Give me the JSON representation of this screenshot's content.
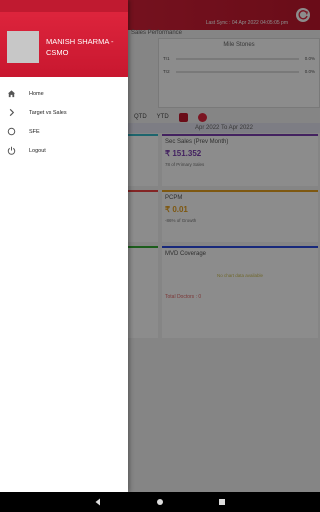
{
  "background": {
    "sync_text": "Last Sync : 04 Apr 2022 04:05:05 pm",
    "panel_title": "Sales Performance",
    "milestones_title": "Mile Stones",
    "milestone_rows": [
      {
        "label": "Tr1",
        "value": "0.0%"
      },
      {
        "label": "Tr2",
        "value": "0.0%"
      }
    ],
    "periods": [
      "QTD",
      "YTD"
    ],
    "date_range": "Apr 2022 To Apr 2022",
    "cards": [
      {
        "title": "Sec Sales (Prev Month)",
        "value": "₹ 151.352",
        "sub": "78 of Primary Sales"
      },
      {
        "title": "PCPM",
        "value": "₹ 0.01",
        "sub": "-86% of Growth"
      },
      {
        "title": "MVD Coverage",
        "no_data": "No chart data available",
        "footer": "Total Doctors : 0"
      }
    ]
  },
  "drawer": {
    "user_name": "MANISH SHARMA - CSMO",
    "items": [
      {
        "label": "Home",
        "icon": "home-icon"
      },
      {
        "label": "Target vs Sales",
        "icon": "chevron-right-icon"
      },
      {
        "label": "SFE",
        "icon": "radio-circle-icon"
      },
      {
        "label": "Logout",
        "icon": "power-icon"
      }
    ]
  },
  "colors": {
    "brand": "#e1273f",
    "brand_dark": "#c1172d"
  }
}
